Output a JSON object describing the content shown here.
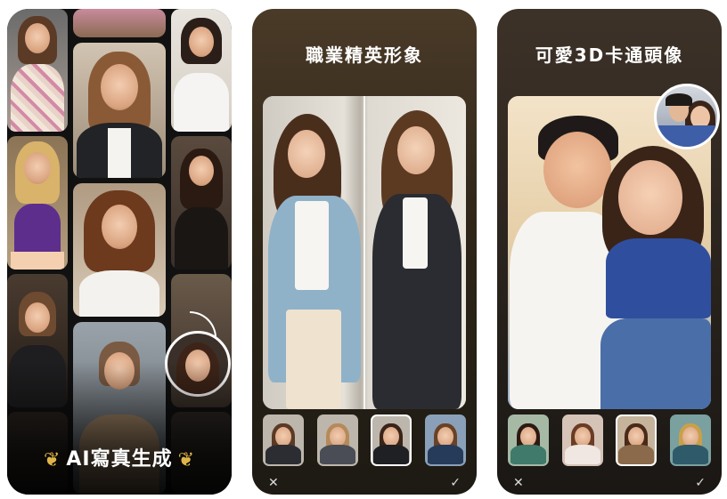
{
  "panels": [
    {
      "id": "photo-wall",
      "title": "AI寫真生成"
    },
    {
      "id": "business",
      "title": "職業精英形象",
      "cancel_glyph": "✕",
      "confirm_glyph": "✓",
      "selected_thumb": 3
    },
    {
      "id": "cartoon",
      "title": "可愛3D卡通頭像",
      "cancel_glyph": "✕",
      "confirm_glyph": "✓",
      "selected_thumb": 3
    }
  ],
  "icons": {
    "laurel_left": "laurel-left-icon",
    "laurel_right": "laurel-right-icon",
    "close": "close-icon",
    "check": "check-icon"
  },
  "colors": {
    "accent_gold": "#e0b548",
    "text_light": "#ffffff"
  }
}
